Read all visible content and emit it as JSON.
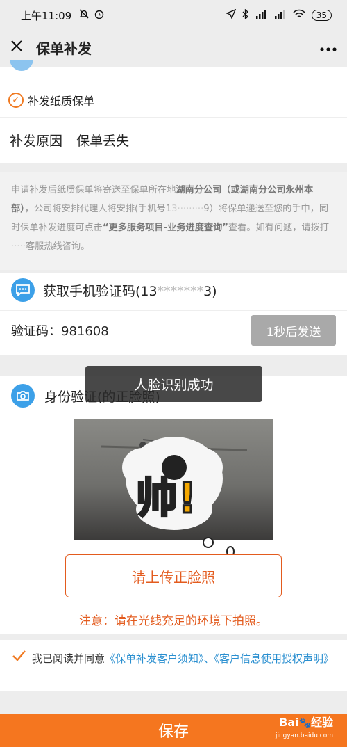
{
  "status": {
    "time": "上午11:09",
    "battery": "35"
  },
  "header": {
    "title": "保单补发"
  },
  "reissue": {
    "option_label": "补发纸质保单",
    "reason_label": "补发原因",
    "reason_value": "保单丢失"
  },
  "notice": {
    "part1": "申请补发后纸质保单将寄送至保单所在地",
    "org": "湖南分公司（或湖南分公司永州本部）",
    "part2": "，公司将安排代理人将安排(手机号1",
    "masked1": "3·········",
    "part3": "9）将保单递送至您的手中，同时保单补发进度可点击",
    "link": "“更多服务项目-业务进度查询”",
    "part4": "查看。如有问题，请拨打",
    "masked2": "·····",
    "part5": "客服热线咨询。"
  },
  "verify": {
    "title": "获取手机验证码(13",
    "masked": "*******",
    "title_end": "3)",
    "code_label": "验证码：",
    "code_value": "981608",
    "send_button": "1秒后发送"
  },
  "toast": {
    "text": "人脸识别成功"
  },
  "identity": {
    "title": "身份验证(的正脸照)",
    "sticker_text": "帅!",
    "upload_button": "请上传正脸照",
    "tip": "注意：请在光线充足的环境下拍照。"
  },
  "agreement": {
    "prefix": "我已阅读并同意",
    "link1": "《保单补发客户须知》",
    "sep": "、",
    "link2": "《客户信息使用授权声明》"
  },
  "footer": {
    "save": "保存"
  },
  "watermark": {
    "brand": "Bai",
    "brand_suffix": "经验",
    "url": "jingyan.baidu.com"
  },
  "colors": {
    "accent": "#f5761f",
    "link": "#2a8fd0",
    "warning": "#e35b1e"
  }
}
